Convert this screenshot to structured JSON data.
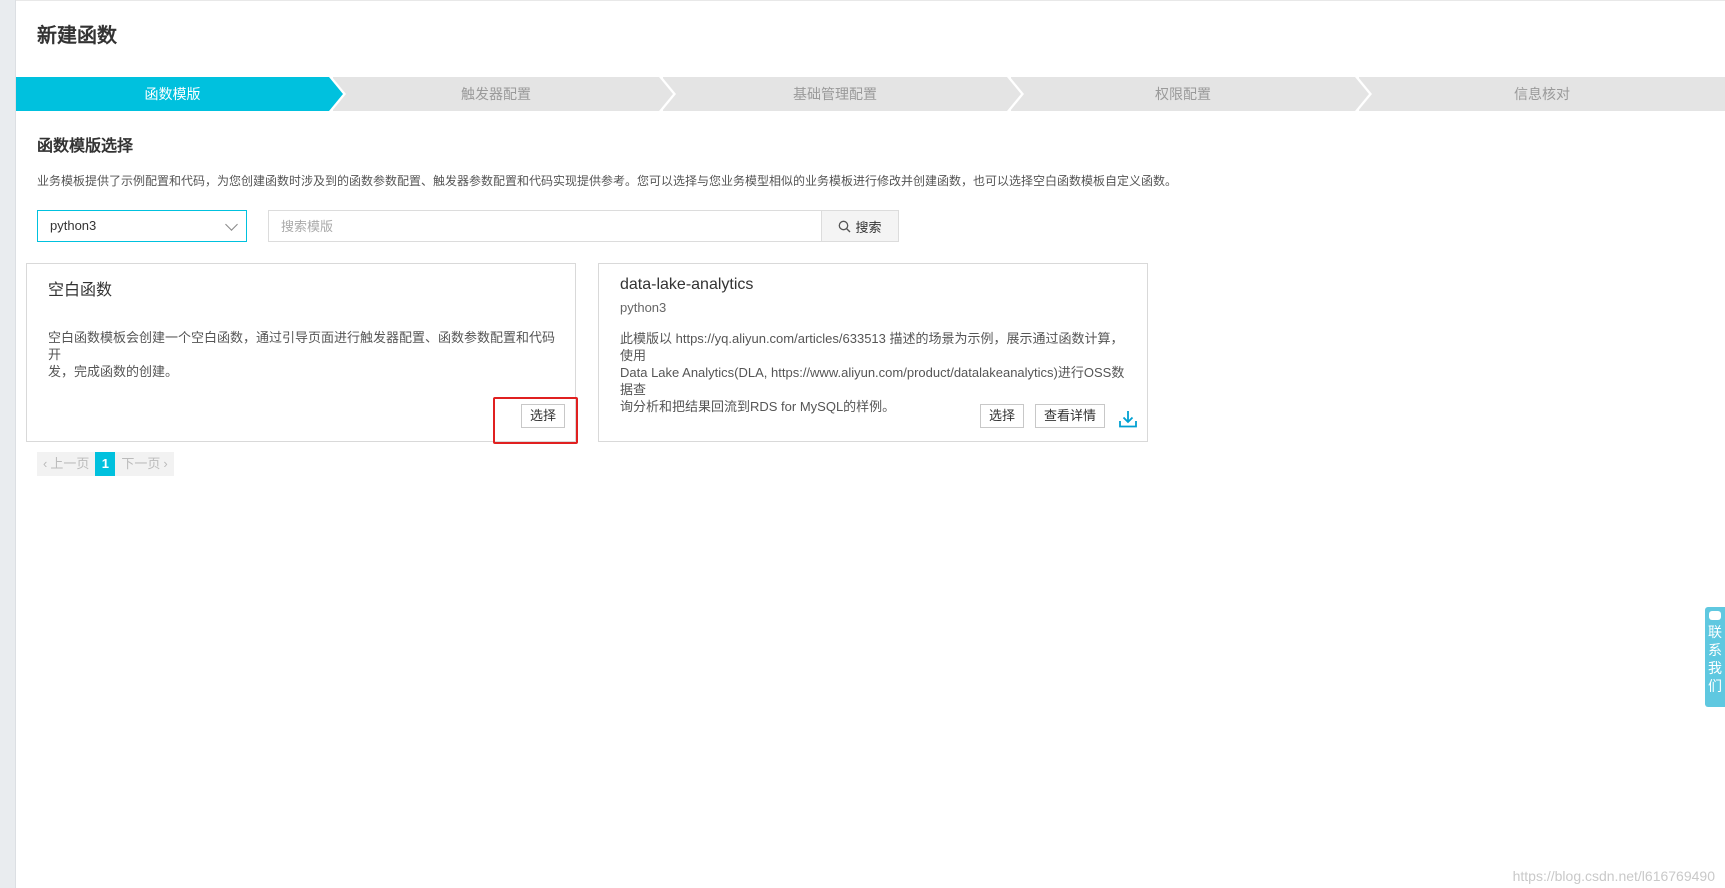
{
  "page": {
    "title": "新建函数"
  },
  "steps": [
    {
      "label": "函数模版",
      "active": true
    },
    {
      "label": "触发器配置",
      "active": false
    },
    {
      "label": "基础管理配置",
      "active": false
    },
    {
      "label": "权限配置",
      "active": false
    },
    {
      "label": "信息核对",
      "active": false
    }
  ],
  "section": {
    "title": "函数模版选择",
    "description": "业务模板提供了示例配置和代码，为您创建函数时涉及到的函数参数配置、触发器参数配置和代码实现提供参考。您可以选择与您业务模型相似的业务模板进行修改并创建函数，也可以选择空白函数模板自定义函数。"
  },
  "filters": {
    "runtime_selected": "python3",
    "search_placeholder": "搜索模版",
    "search_value": "",
    "search_button": "搜索",
    "search_icon": "magnifier-icon"
  },
  "cards": [
    {
      "title": "空白函数",
      "subtitle": "",
      "description_line1": "空白函数模板会创建一个空白函数，通过引导页面进行触发器配置、函数参数配置和代码开",
      "description_line2": "发，完成函数的创建。",
      "select_label": "选择",
      "highlighted": true
    },
    {
      "title": "data-lake-analytics",
      "subtitle": "python3",
      "description_line1": "此模版以 https://yq.aliyun.com/articles/633513 描述的场景为示例，展示通过函数计算，使用",
      "description_line2": "Data Lake Analytics(DLA, https://www.aliyun.com/product/datalakeanalytics)进行OSS数据查",
      "description_line3": "询分析和把结果回流到RDS for MySQL的样例。",
      "select_label": "选择",
      "details_label": "查看详情",
      "download_icon": "download-icon"
    }
  ],
  "pagination": {
    "prev": "上一页",
    "current": "1",
    "next": "下一页"
  },
  "contact": {
    "chars": [
      "联",
      "系",
      "我",
      "们"
    ]
  },
  "watermark": "https://blog.csdn.net/l616769490",
  "colors": {
    "accent": "#00c1de",
    "highlight": "#e02020",
    "step_inactive": "#e4e4e4"
  }
}
